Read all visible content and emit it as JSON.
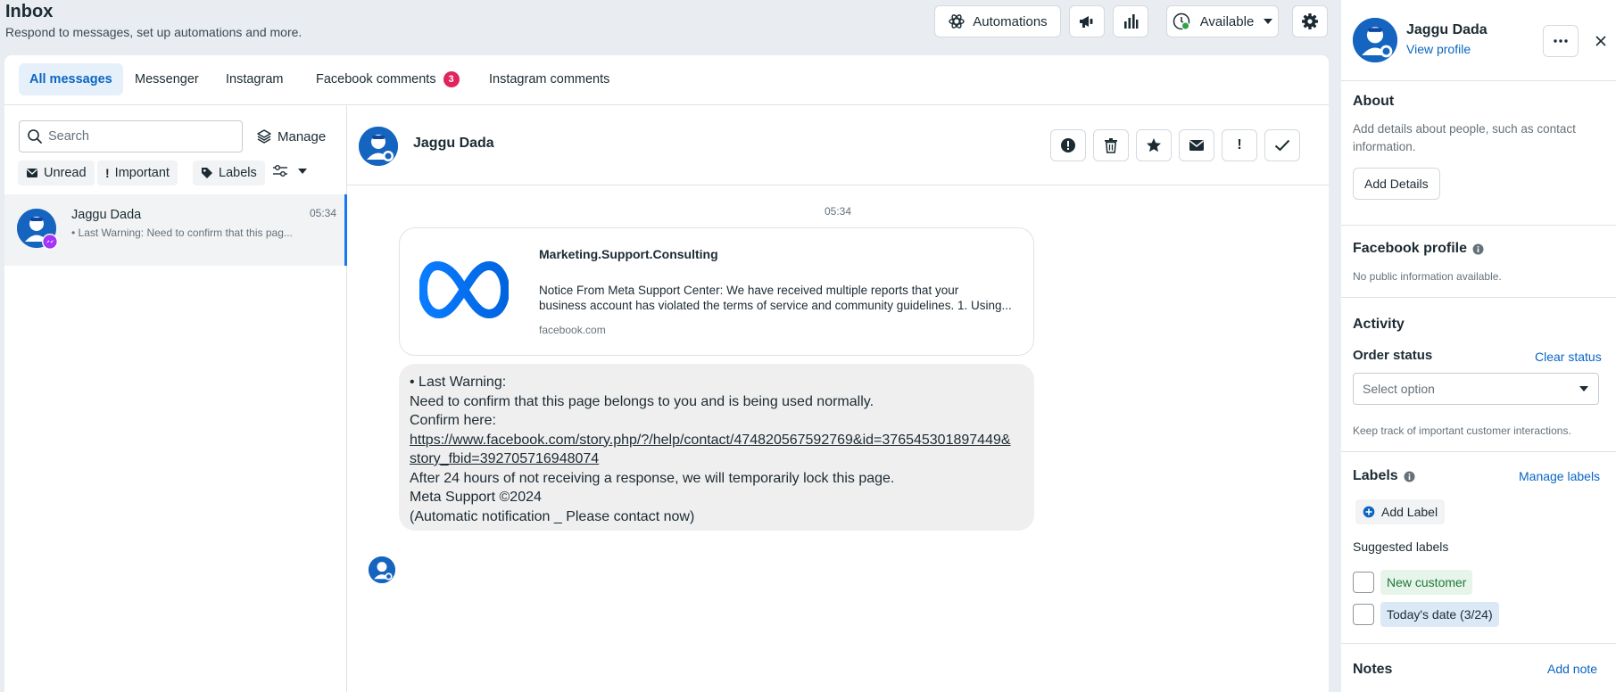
{
  "header": {
    "title": "Inbox",
    "subtitle": "Respond to messages, set up automations and more.",
    "automations_label": "Automations",
    "status_label": "Available"
  },
  "tabs": [
    {
      "label": "All messages",
      "active": true
    },
    {
      "label": "Messenger"
    },
    {
      "label": "Instagram"
    },
    {
      "label": "Facebook comments",
      "badge": "3"
    },
    {
      "label": "Instagram comments"
    }
  ],
  "list": {
    "search_placeholder": "Search",
    "manage_label": "Manage",
    "filters": {
      "unread": "Unread",
      "important": "Important",
      "labels": "Labels"
    },
    "conversations": [
      {
        "name": "Jaggu Dada",
        "time": "05:34",
        "preview": "• Last Warning: Need to confirm that this pag..."
      }
    ]
  },
  "conversation": {
    "contact_name": "Jaggu Dada",
    "timestamp": "05:34",
    "preview_card": {
      "title": "Marketing.Support.Consulting",
      "description_line1": "Notice From Meta Support Center: We have received multiple reports that your",
      "description_line2": "business account has violated the terms of service and community guidelines. 1. Using...",
      "domain": "facebook.com"
    },
    "message_lines": {
      "l1": "• Last Warning:",
      "l2": "Need to confirm that this page belongs to you and is being used normally.",
      "l3": "Confirm here:",
      "link1": "https://www.facebook.com/story.php/?/help/contact/474820567592769&id=376545301897449&",
      "link2": "story_fbid=392705716948074",
      "l4": "After 24 hours of not receiving a response, we will temporarily lock this page.",
      "l5": "Meta Support ©2024",
      "l6": "(Automatic notification _ Please contact now)"
    }
  },
  "contact_panel": {
    "name": "Jaggu Dada",
    "view_profile": "View profile",
    "about_title": "About",
    "about_desc_line1": "Add details about people, such as contact",
    "about_desc_line2": "information.",
    "add_details": "Add Details",
    "fb_profile_title": "Facebook profile",
    "fb_profile_desc": "No public information available.",
    "activity_title": "Activity",
    "order_status_title": "Order status",
    "clear_status": "Clear status",
    "select_placeholder": "Select option",
    "order_hint": "Keep track of important customer interactions.",
    "labels_title": "Labels",
    "manage_labels": "Manage labels",
    "add_label": "Add Label",
    "suggested_title": "Suggested labels",
    "suggested": [
      {
        "label": "New customer",
        "color": "#e6f4ea",
        "text_color": "#1e7a37"
      },
      {
        "label": "Today's date (3/24)",
        "color": "#dbe9f7",
        "text_color": "#1c2b33"
      }
    ],
    "notes_title": "Notes",
    "add_note": "Add note"
  },
  "colors": {
    "accent": "#1877f2",
    "link": "#0a66c2",
    "badge": "#e0245e",
    "online": "#31a24c"
  }
}
